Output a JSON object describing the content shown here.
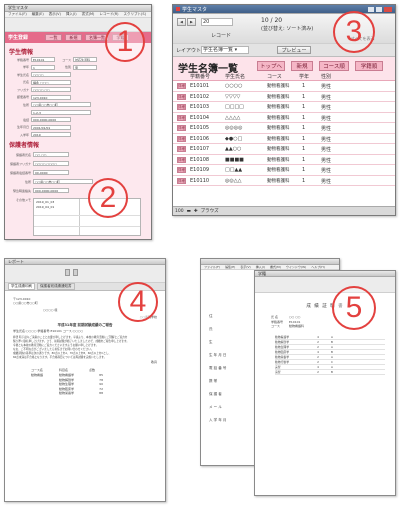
{
  "panel1": {
    "window_title": "学生マスタ",
    "menu": [
      "ファイル(F)",
      "編集(E)",
      "表示(V)",
      "挿入(I)",
      "書式(M)",
      "レコード(R)",
      "スクリプト(S)",
      "ウインドウ(W)",
      "ヘルプ(H)"
    ],
    "header_label": "学生登録",
    "tabs": [
      "一覧",
      "新規",
      "名簿一覧",
      "学籍"
    ],
    "section_student": "学生情報",
    "fields": [
      {
        "label": "学籍番号",
        "value": "E10101",
        "extra": "コース",
        "extra_value": "対応生活科"
      },
      {
        "label": "学年",
        "value": "1",
        "extra": "性別",
        "extra_value": "男"
      },
      {
        "label": "学生氏名",
        "value": "○○○○"
      },
      {
        "label": "氏名",
        "value": "福永 □□□"
      },
      {
        "label": "フリガナ",
        "value": "○○○○ ○○"
      },
      {
        "label": "郵便番号",
        "value": "123-0010"
      },
      {
        "label": "住所",
        "value": "○○県○○市○○町"
      },
      {
        "label": "",
        "value": "1-2-3"
      },
      {
        "label": "電話",
        "value": "000-0000-0000"
      },
      {
        "label": "生年月日",
        "value": "2001/01/01"
      },
      {
        "label": "入学年",
        "value": "2019"
      }
    ],
    "section_guardian": "保護者情報",
    "guardian_fields": [
      {
        "label": "保護者氏名",
        "value": "○○ ○○"
      },
      {
        "label": "保護者フリガナ",
        "value": "○○○○ ○○○○"
      },
      {
        "label": "保護者電話番号",
        "value": "00-0000"
      },
      {
        "label": "住所",
        "value": "○○県○○市○○町"
      },
      {
        "label": "緊急時連絡先",
        "value": "000-0000-0000"
      }
    ],
    "memo_label": "その他メモ",
    "memo_lines": [
      "2019_01_03",
      "2019_04_01"
    ],
    "number": "1"
  },
  "panel2": {
    "number": "2"
  },
  "panel3": {
    "window_title": "学生マスタ",
    "record_no": "20",
    "record_count": "10 / 20",
    "record_status": "(並び替え: ソート済み)",
    "record_label": "レコード",
    "show_all_label": "すべてを表示",
    "layout_label": "レイアウト:",
    "layout_value": "学生名簿一覧",
    "preview_label": "プレビュー",
    "page_title": "学生名簿一覧",
    "nav_buttons": [
      "トップへ",
      "新規",
      "コース順",
      "学籍順"
    ],
    "columns": [
      "学籍番号",
      "学生氏名",
      "コース",
      "学年",
      "性別"
    ],
    "rows": [
      {
        "btn": "詳細",
        "id": "E10101",
        "name": "○○○○",
        "course": "動物看護科",
        "year": "1",
        "sex": "男性"
      },
      {
        "btn": "詳細",
        "id": "E10102",
        "name": "▽▽▽▽",
        "course": "動物看護科",
        "year": "1",
        "sex": "男性"
      },
      {
        "btn": "詳細",
        "id": "E10103",
        "name": "□□□□",
        "course": "動物看護科",
        "year": "1",
        "sex": "男性"
      },
      {
        "btn": "詳細",
        "id": "E10104",
        "name": "△△△△",
        "course": "動物看護科",
        "year": "1",
        "sex": "男性"
      },
      {
        "btn": "詳細",
        "id": "E10105",
        "name": "◎◎◎◎",
        "course": "動物看護科",
        "year": "1",
        "sex": "男性"
      },
      {
        "btn": "詳細",
        "id": "E10106",
        "name": "◆●○□",
        "course": "動物看護科",
        "year": "1",
        "sex": "男性"
      },
      {
        "btn": "詳細",
        "id": "E10107",
        "name": "▲▲○○",
        "course": "動物看護科",
        "year": "1",
        "sex": "男性"
      },
      {
        "btn": "詳細",
        "id": "E10108",
        "name": "■■■■",
        "course": "動物看護科",
        "year": "1",
        "sex": "男性"
      },
      {
        "btn": "詳細",
        "id": "E10109",
        "name": "□□▲▲",
        "course": "動物看護科",
        "year": "1",
        "sex": "男性"
      },
      {
        "btn": "詳細",
        "id": "E10110",
        "name": "◎◎△△",
        "course": "動物看護科",
        "year": "1",
        "sex": "男性"
      }
    ],
    "zoom": "100",
    "status_mode": "ブラウズ",
    "number": "3"
  },
  "panel4": {
    "window_title": "レポート",
    "number": "4",
    "tabs": [
      "学生成績印刷",
      "保護者宛成績通知書"
    ],
    "address_lines": [
      "〒123-0010",
      "○○県○○市○○町"
    ],
    "addressee": "○○○○ 様",
    "school_name": "○○専門学校",
    "title": "平成31年度 前期試験成績のご報告",
    "student_line": "学生氏名:○○○○   学籍番号:E10101   コース:○○○○",
    "body_lines": [
      "拝啓 時下益々ご清栄のこととお慶び申し上げます。平素より、本校の教育活動にご理解とご協力を",
      "賜り厚く御礼申し上げます。さて、前期試験が終了いたしましたので、成績をご報告申し上げます。",
      "今後とも本校の教育活動にご協力くださいますようお願い申し上げます。",
      "なお、ご不明な点がございましたら担任までお問い合わせください。",
      "成績評価の基準は次の通りです。80点以上をA、70点以上をB、60点以上をCとし、",
      "60点未満は不合格となります。不合格科目については再試験を実施いたします。"
    ],
    "closing": "敬具",
    "grades_header": [
      "コース名",
      "科目名",
      "点数"
    ],
    "grades": [
      {
        "course": "動物看護",
        "subject": "動物看護学",
        "score": "85"
      },
      {
        "course": "",
        "subject": "動物解剖学",
        "score": "78"
      },
      {
        "course": "",
        "subject": "動物生理学",
        "score": "90"
      },
      {
        "course": "",
        "subject": "動物臨床学",
        "score": "72"
      },
      {
        "course": "",
        "subject": "動物栄養学",
        "score": "88"
      }
    ]
  },
  "panel5": {
    "window_title": "学籍",
    "number": "5",
    "menu": [
      "ファイル(F)",
      "編集(E)",
      "表示(V)",
      "挿入(I)",
      "書式(M)",
      "ウインドウ(W)",
      "ヘルプ(H)"
    ],
    "doc_title": "成 績 証 明 書",
    "doc_labels": [
      "氏 名",
      "学籍番号",
      "コース"
    ],
    "doc_values": [
      "○○ ○○",
      "E10101",
      "動物看護科"
    ],
    "side_labels": [
      "住",
      "氏",
      "生",
      "生 年 月 日",
      "電 話 番 号",
      "携 帯",
      "保 護 者",
      "メ ー ル",
      "入 学 年 月"
    ],
    "table_rows": [
      [
        "動物看護学",
        "4",
        "A"
      ],
      [
        "動物解剖学",
        "2",
        "B"
      ],
      [
        "動物生理学",
        "2",
        "A"
      ],
      [
        "動物臨床学",
        "4",
        "B"
      ],
      [
        "動物栄養学",
        "2",
        "A"
      ],
      [
        "動物行動学",
        "2",
        "C"
      ],
      [
        "実習",
        "4",
        "A"
      ],
      [
        "演習",
        "2",
        "B"
      ]
    ]
  }
}
